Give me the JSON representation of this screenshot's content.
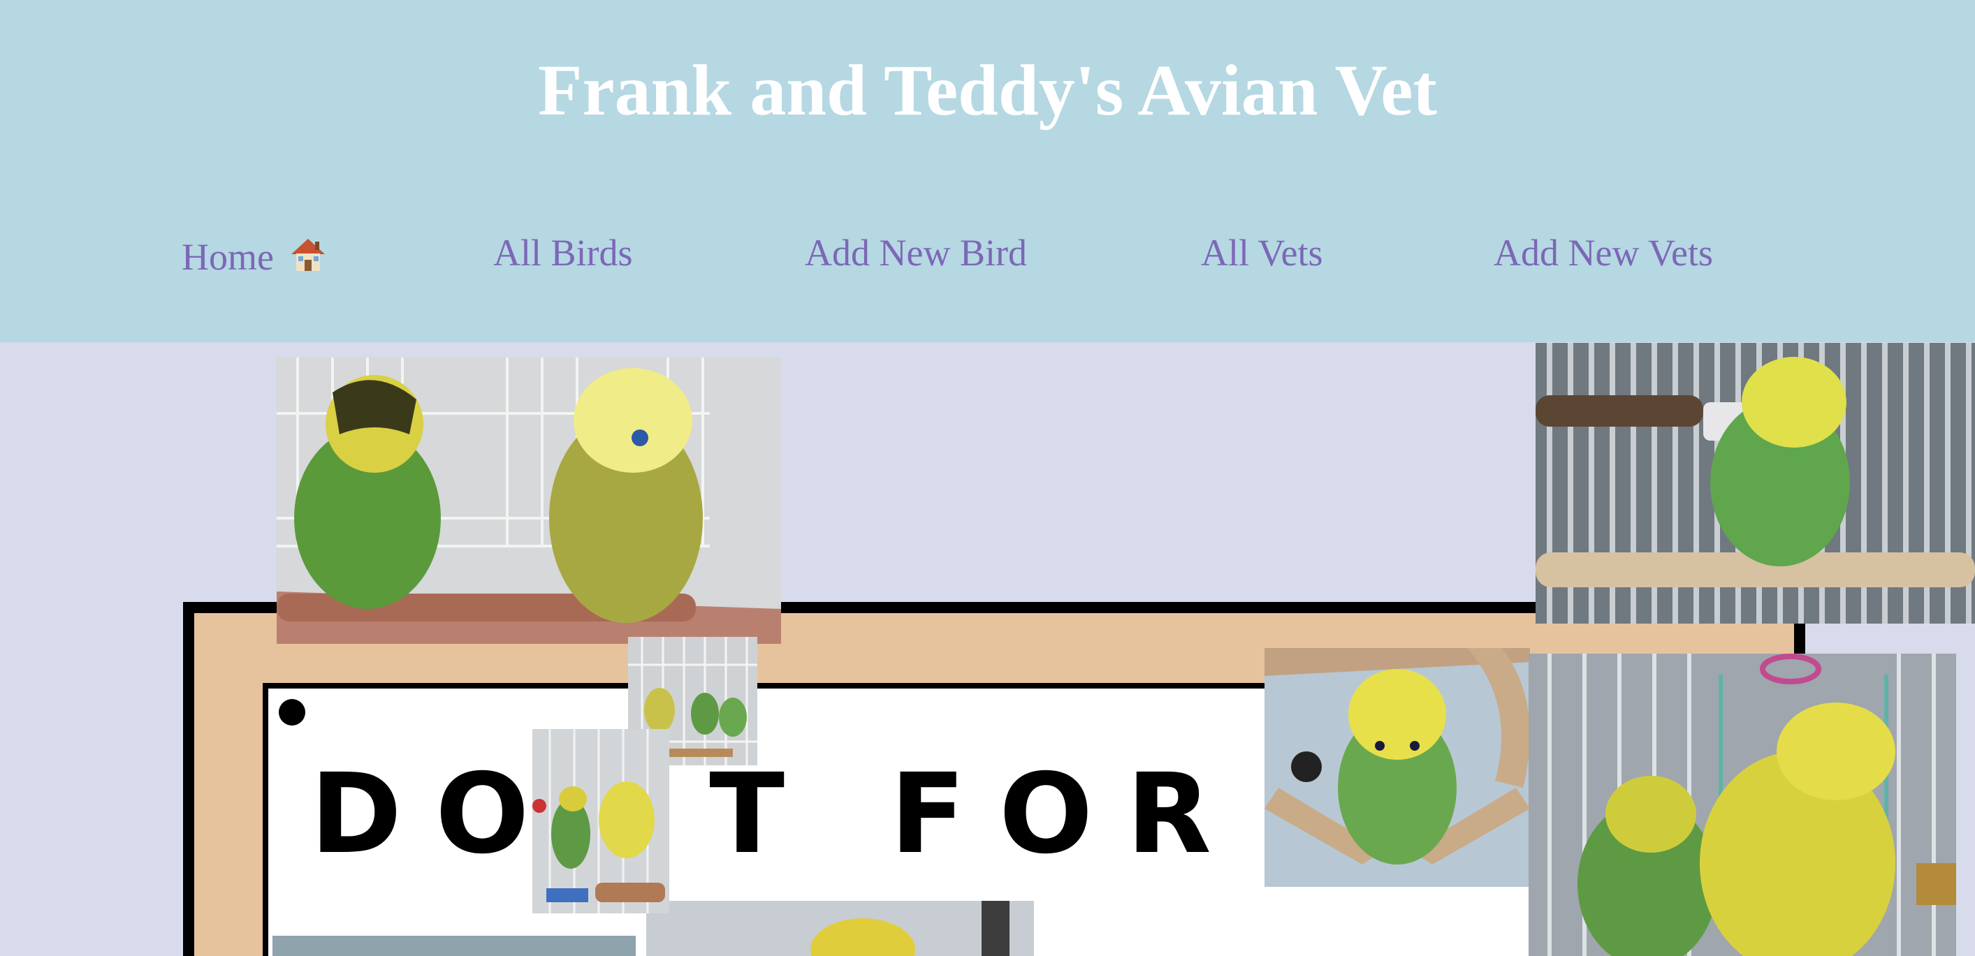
{
  "header": {
    "title": "Frank and Teddy's Avian Vet"
  },
  "nav": {
    "home": "Home",
    "all_birds": "All Birds",
    "add_new_bird": "Add New Bird",
    "all_vets": "All Vets",
    "add_new_vets": "Add New Vets"
  },
  "poster": {
    "text": "DO IT FOR"
  },
  "colors": {
    "header_bg": "#b5d8e3",
    "page_bg": "#d8dbeb",
    "title": "#ffffff",
    "nav_link": "#7c67b6"
  },
  "icons": {
    "home": "house-icon"
  }
}
